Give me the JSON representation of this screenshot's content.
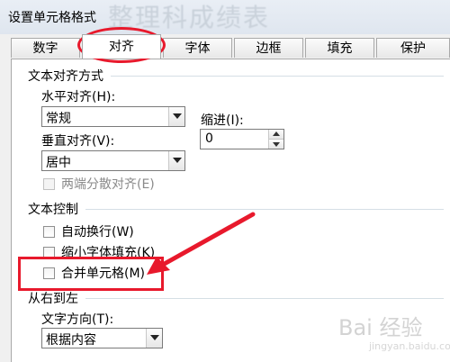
{
  "window": {
    "title": "设置单元格格式",
    "ghost_title": "整理科成绩表"
  },
  "tabs": [
    {
      "label": "数字"
    },
    {
      "label": "对齐",
      "active": true
    },
    {
      "label": "字体"
    },
    {
      "label": "边框"
    },
    {
      "label": "填充"
    },
    {
      "label": "保护"
    }
  ],
  "alignment": {
    "section_title": "文本对齐方式",
    "horizontal_label": "水平对齐(H):",
    "horizontal_value": "常规",
    "indent_label": "缩进(I):",
    "indent_value": "0",
    "vertical_label": "垂直对齐(V):",
    "vertical_value": "居中",
    "distributed_label": "两端分散对齐(E)"
  },
  "text_control": {
    "section_title": "文本控制",
    "wrap_label": "自动换行(W)",
    "shrink_label": "缩小字体填充(K)",
    "merge_label": "合并单元格(M)"
  },
  "rtl": {
    "section_title": "从右到左",
    "direction_label": "文字方向(T):",
    "direction_value": "根据内容"
  },
  "watermark": {
    "logo_text": "Bai 经验",
    "url": "jingyan.baidu.com"
  },
  "colors": {
    "highlight": "#e8192c"
  }
}
